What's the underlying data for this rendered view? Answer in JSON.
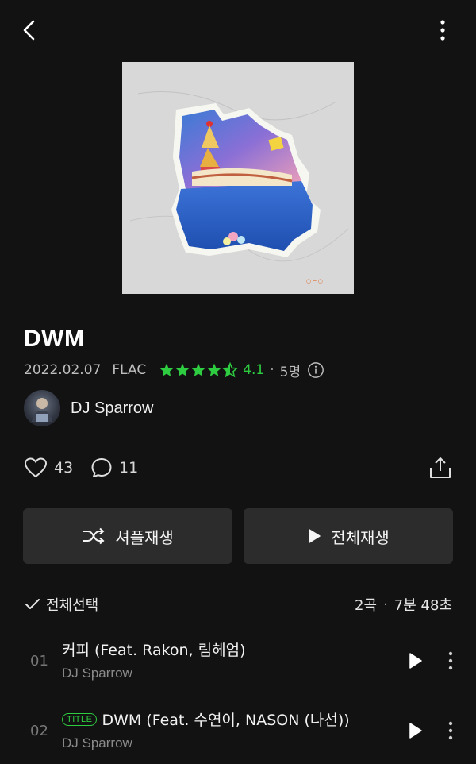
{
  "album": {
    "title": "DWM",
    "date": "2022.02.07",
    "format": "FLAC",
    "rating": "4.1",
    "rating_separator": "·",
    "rating_count": "5명",
    "artist": "DJ Sparrow"
  },
  "stats": {
    "likes": "43",
    "comments": "11"
  },
  "buttons": {
    "shuffle": "셔플재생",
    "play_all": "전체재생"
  },
  "list_header": {
    "select_all": "전체선택",
    "track_count": "2곡",
    "separator": "·",
    "duration": "7분 48초"
  },
  "tracks": [
    {
      "number": "01",
      "title": "커피 (Feat. Rakon, 림헤엄)",
      "artist": "DJ Sparrow",
      "badge": ""
    },
    {
      "number": "02",
      "title": "DWM (Feat. 수연이, NASON (나선))",
      "artist": "DJ Sparrow",
      "badge": "TITLE"
    }
  ],
  "colors": {
    "accent": "#2ecc40",
    "background": "#121212",
    "button_bg": "#2c2c2c"
  },
  "icons": [
    "back-icon",
    "more-vertical-icon",
    "star-icon",
    "star-half-icon",
    "info-icon",
    "heart-icon",
    "comment-icon",
    "share-icon",
    "shuffle-icon",
    "play-icon",
    "check-icon"
  ]
}
